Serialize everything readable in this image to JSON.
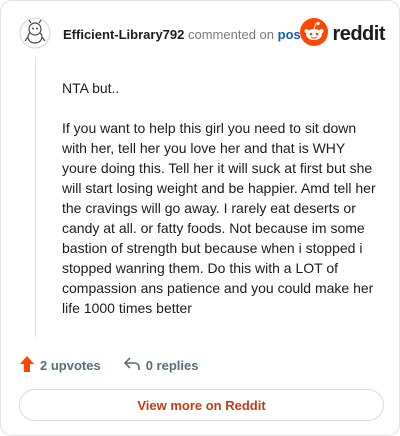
{
  "header": {
    "author": "Efficient-Library792",
    "commented_text": "commented on",
    "post_link": "post",
    "logo_icon": "reddit-snoo-icon",
    "logo_word": "reddit"
  },
  "comment": {
    "paragraphs": [
      "NTA but..",
      "If you want to help this girl you need to sit down with her, tell her you love her and that is WHY youre doing this. Tell her it will suck at first but she will start losing weight and be happier. Amd tell her the cravings will go away. I rarely eat deserts or candy at all. or fatty foods. Not because im some bastion of strength but because when i stopped i stopped wanring them. Do this with a LOT of compassion ans patience and you could make her life 1000 times better"
    ]
  },
  "actions": {
    "upvotes_label": "2 upvotes",
    "replies_label": "0 replies",
    "upvote_icon": "upvote-arrow-icon",
    "reply_icon": "reply-arrow-icon"
  },
  "footer": {
    "view_more_label": "View more on Reddit"
  },
  "colors": {
    "accent": "#ff4500",
    "link": "#0f5fbf",
    "button_text": "#c13d18",
    "muted": "#576f76"
  }
}
